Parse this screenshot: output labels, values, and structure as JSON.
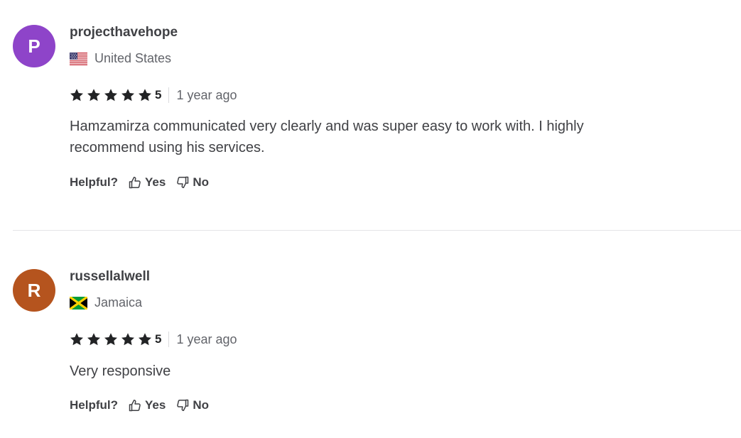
{
  "reviews": [
    {
      "avatar_letter": "P",
      "avatar_color": "#8e44c9",
      "username": "projecthavehope",
      "country": "United States",
      "flag_icon": "us-flag-icon",
      "rating": "5",
      "time": "1 year ago",
      "text": "Hamzamirza communicated very clearly and was super easy to work with. I highly recommend using his services.",
      "helpful_label": "Helpful?",
      "yes_label": "Yes",
      "no_label": "No"
    },
    {
      "avatar_letter": "R",
      "avatar_color": "#b5541e",
      "username": "russellalwell",
      "country": "Jamaica",
      "flag_icon": "jamaica-flag-icon",
      "rating": "5",
      "time": "1 year ago",
      "text": "Very responsive",
      "helpful_label": "Helpful?",
      "yes_label": "Yes",
      "no_label": "No"
    }
  ],
  "colors": {
    "star": "#222325",
    "text": "#404145",
    "muted": "#62646a",
    "divider": "#e4e5e7"
  }
}
